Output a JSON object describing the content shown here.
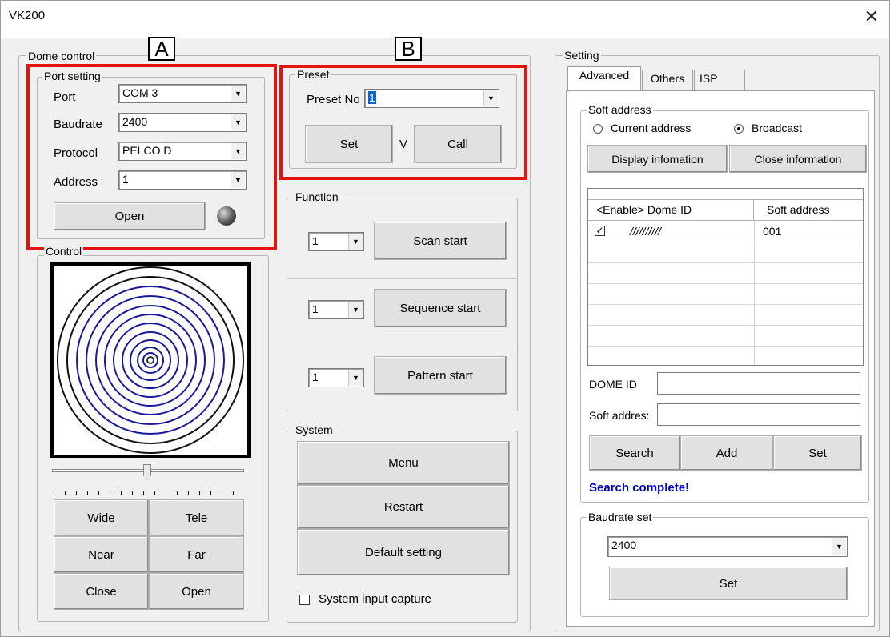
{
  "window": {
    "title": "VK200",
    "close_glyph": "✕"
  },
  "callouts": {
    "a": "A",
    "b": "B"
  },
  "dome_control": {
    "legend": "Dome control",
    "port_setting": {
      "legend": "Port setting",
      "port_label": "Port",
      "port_value": "COM 3",
      "baudrate_label": "Baudrate",
      "baudrate_value": "2400",
      "protocol_label": "Protocol",
      "protocol_value": "PELCO D",
      "address_label": "Address",
      "address_value": "1",
      "open_button": "Open"
    },
    "control": {
      "legend": "Control",
      "buttons": {
        "wide": "Wide",
        "tele": "Tele",
        "near": "Near",
        "far": "Far",
        "close": "Close",
        "open": "Open"
      }
    },
    "preset": {
      "legend": "Preset",
      "preset_no_label": "Preset No",
      "preset_no_value": "1",
      "set_button": "Set",
      "v_label": "V",
      "call_button": "Call"
    },
    "function": {
      "legend": "Function",
      "rows": [
        {
          "value": "1",
          "button": "Scan start"
        },
        {
          "value": "1",
          "button": "Sequence start"
        },
        {
          "value": "1",
          "button": "Pattern start"
        }
      ]
    },
    "system": {
      "legend": "System",
      "menu_button": "Menu",
      "restart_button": "Restart",
      "default_button": "Default setting",
      "capture_label": "System input capture",
      "capture_checked": false
    }
  },
  "setting": {
    "legend": "Setting",
    "tabs": [
      "Advanced",
      "Others",
      "ISP"
    ],
    "active_tab": "Advanced",
    "soft_address": {
      "legend": "Soft address",
      "radio_current": "Current address",
      "radio_broadcast": "Broadcast",
      "selected": "Broadcast",
      "display_button": "Display infomation",
      "close_button": "Close information",
      "table": {
        "headers": [
          "<Enable> Dome ID",
          "Soft address"
        ],
        "rows": [
          {
            "enabled": true,
            "dome_id": "//////////",
            "soft_address": "001"
          }
        ]
      },
      "dome_id_label": "DOME ID",
      "dome_id_value": "",
      "soft_addr_label": "Soft addres:",
      "soft_addr_value": "",
      "search_button": "Search",
      "add_button": "Add",
      "set_button": "Set",
      "status": "Search complete!",
      "status_color": "#0000cc"
    },
    "baudrate_set": {
      "legend": "Baudrate set",
      "value": "2400",
      "set_button": "Set"
    }
  },
  "colors": {
    "callout_border": "#e4130f",
    "rings": "#1a1a99"
  }
}
